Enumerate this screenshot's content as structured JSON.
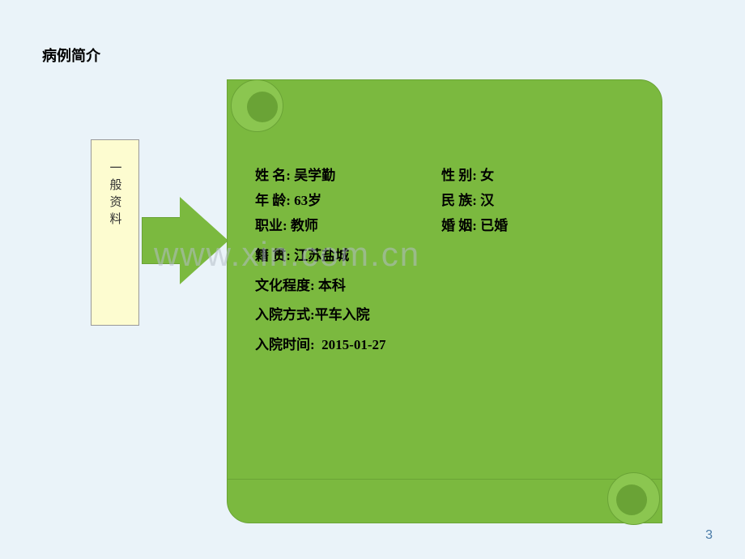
{
  "title": "病例简介",
  "sidebar_label": "一般资料",
  "patient": {
    "name_label": "姓 名:",
    "name": "吴学勤",
    "gender_label": "性 别:",
    "gender": "女",
    "age_label": "年 龄:",
    "age": "63岁",
    "ethnicity_label": "民 族:",
    "ethnicity": "汉",
    "occupation_label": "职业:",
    "occupation": "教师",
    "marriage_label": "婚 姻:",
    "marriage": "已婚",
    "hometown_label": "籍 贯:",
    "hometown": "江苏盐城",
    "education_label": "文化程度:",
    "education": "本科",
    "admission_method_label": "入院方式:",
    "admission_method": "平车入院",
    "admission_time_label": "入院时间:",
    "admission_time": "2015-01-27"
  },
  "watermark": "www.xin.com.cn",
  "page_number": "3"
}
